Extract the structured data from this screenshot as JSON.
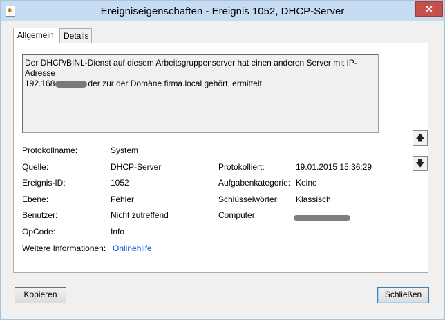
{
  "window": {
    "title": "Ereigniseigenschaften - Ereignis 1052, DHCP-Server",
    "close_symbol": "✕"
  },
  "tabs": [
    {
      "label": "Allgemein",
      "active": true
    },
    {
      "label": "Details",
      "active": false
    }
  ],
  "description": {
    "line1": "Der DHCP/BINL-Dienst auf diesem Arbeitsgruppenserver hat einen anderen Server mit IP-Adresse",
    "line2_prefix": "192.168",
    "line2_suffix": "der zur der Domäne firma.local gehört, ermittelt."
  },
  "properties": {
    "protokollname": {
      "label": "Protokollname:",
      "value": "System"
    },
    "quelle": {
      "label": "Quelle:",
      "value": "DHCP-Server"
    },
    "ereignis_id": {
      "label": "Ereignis-ID:",
      "value": "1052"
    },
    "ebene": {
      "label": "Ebene:",
      "value": "Fehler"
    },
    "benutzer": {
      "label": "Benutzer:",
      "value": "Nicht zutreffend"
    },
    "opcode": {
      "label": "OpCode:",
      "value": "Info"
    },
    "weitere": {
      "label": "Weitere Informationen:",
      "link": "Onlinehilfe"
    },
    "protokolliert": {
      "label": "Protokolliert:",
      "value": "19.01.2015 15:36:29"
    },
    "aufgabenkategorie": {
      "label": "Aufgabenkategorie:",
      "value": "Keine"
    },
    "schluesselwoerter": {
      "label": "Schlüsselwörter:",
      "value": "Klassisch"
    },
    "computer": {
      "label": "Computer:"
    }
  },
  "side_buttons": {
    "up_icon": "arrow-up-icon",
    "down_icon": "arrow-down-icon",
    "up": "🡅",
    "down": "🡇"
  },
  "buttons": {
    "copy": "Kopieren",
    "close": "Schließen"
  }
}
